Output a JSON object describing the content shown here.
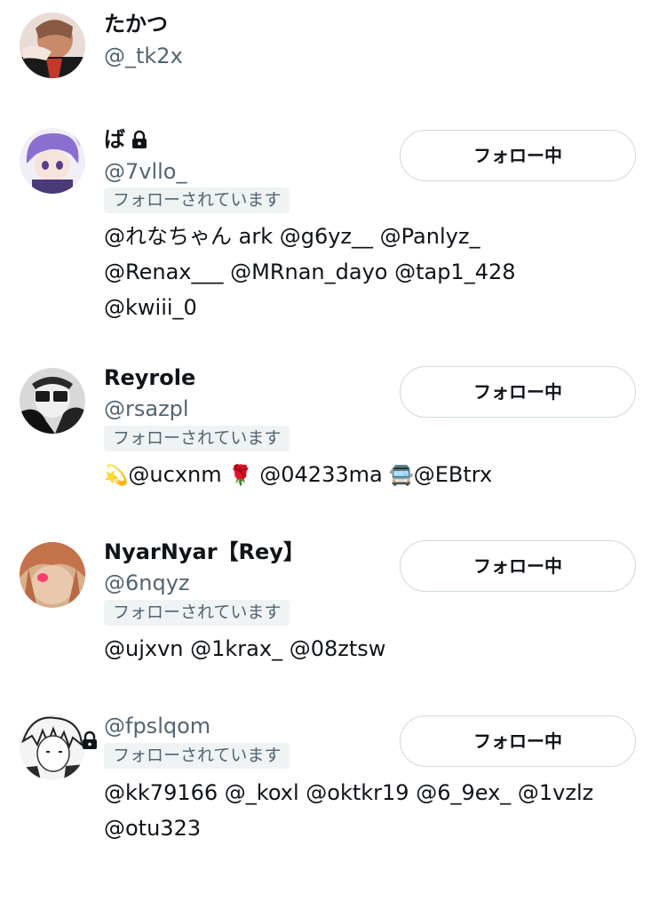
{
  "users": [
    {
      "display_name": "たかつ",
      "handle": "@_tk2x",
      "protected": false
    },
    {
      "display_name": "ば",
      "handle": "@7vllo_",
      "protected": true,
      "follows_you": "フォローされています",
      "button": "フォロー中",
      "bio_lines": [
        "@れなちゃん ark @g6yz__ @Panlyz_",
        "@Renax___ @MRnan_dayo @tap1_428",
        "@kwiii_0"
      ]
    },
    {
      "display_name": "Reyrole",
      "handle": "@rsazpl",
      "protected": false,
      "follows_you": "フォローされています",
      "button": "フォロー中",
      "bio_parts": [
        "💫",
        "@ucxnm ",
        "🌹",
        " @04233ma ",
        "🚍",
        "@EBtrx"
      ]
    },
    {
      "display_name": "NyarNyar【Rey】",
      "handle": "@6nqyz",
      "protected": false,
      "follows_you": "フォローされています",
      "button": "フォロー中",
      "bio_lines": [
        "@ujxvn @1krax_ @08ztsw"
      ]
    },
    {
      "display_name": "",
      "handle": "@fpslqom",
      "protected": true,
      "follows_you": "フォローされています",
      "button": "フォロー中",
      "bio_lines": [
        "@kk79166 @_koxl @oktkr19 @6_9ex_ @1vzlz",
        "@otu323"
      ]
    }
  ],
  "colors": {
    "text_primary": "#0f1419",
    "text_secondary": "#536471",
    "badge_background": "#eff3f4",
    "button_border": "#cfd9de"
  },
  "icons": {
    "protected": "lock-icon"
  }
}
